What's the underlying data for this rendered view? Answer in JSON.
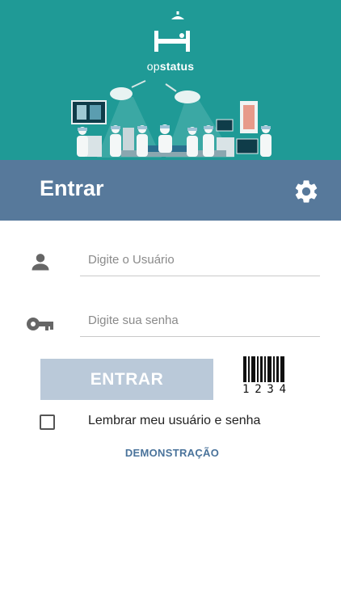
{
  "brand": {
    "name_prefix": "op",
    "name_suffix": "status"
  },
  "colors": {
    "banner": "#1f9a96",
    "header": "#57799b",
    "button": "#bac9d9",
    "link": "#4a739b"
  },
  "header": {
    "title": "Entrar",
    "settings_icon": "gear-icon"
  },
  "form": {
    "username": {
      "placeholder": "Digite o Usuário",
      "value": "",
      "icon": "user-icon"
    },
    "password": {
      "placeholder": "Digite sua senha",
      "value": "",
      "icon": "key-icon"
    },
    "login_label": "ENTRAR",
    "barcode": {
      "icon": "barcode-icon",
      "digits": [
        "1",
        "2",
        "3",
        "4"
      ]
    },
    "remember": {
      "label": "Lembrar meu usuário e senha",
      "checked": false
    },
    "demo_link": "DEMONSTRAÇÃO"
  }
}
